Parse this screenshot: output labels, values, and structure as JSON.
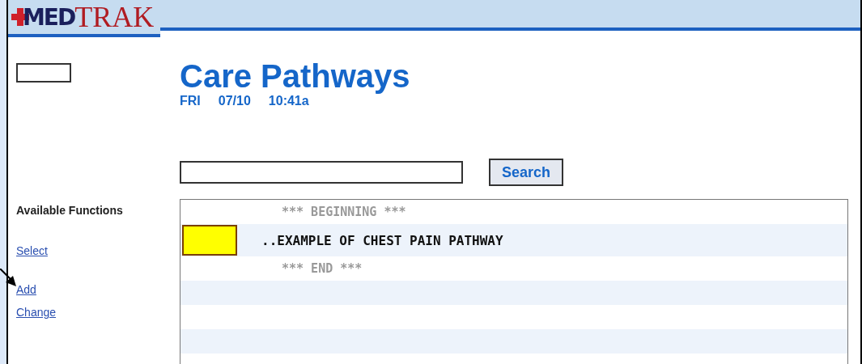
{
  "logo": {
    "prefix": "MED",
    "suffix": "TRAK"
  },
  "sidebar": {
    "heading": "Available Functions",
    "links": [
      {
        "label": "Select"
      },
      {
        "label": "Add"
      },
      {
        "label": "Change"
      }
    ]
  },
  "page": {
    "title": "Care Pathways",
    "day": "FRI",
    "date": "07/10",
    "time": "10:41a"
  },
  "search": {
    "button": "Search"
  },
  "list": {
    "rows": [
      {
        "kind": "boundary",
        "text": "*** BEGINNING ***"
      },
      {
        "kind": "item",
        "text": "..EXAMPLE OF CHEST PAIN PATHWAY",
        "marked": true
      },
      {
        "kind": "boundary",
        "text": "*** END ***"
      },
      {
        "kind": "empty"
      },
      {
        "kind": "empty"
      },
      {
        "kind": "empty"
      },
      {
        "kind": "empty"
      }
    ]
  },
  "annotation": {
    "kind": "arrow"
  }
}
